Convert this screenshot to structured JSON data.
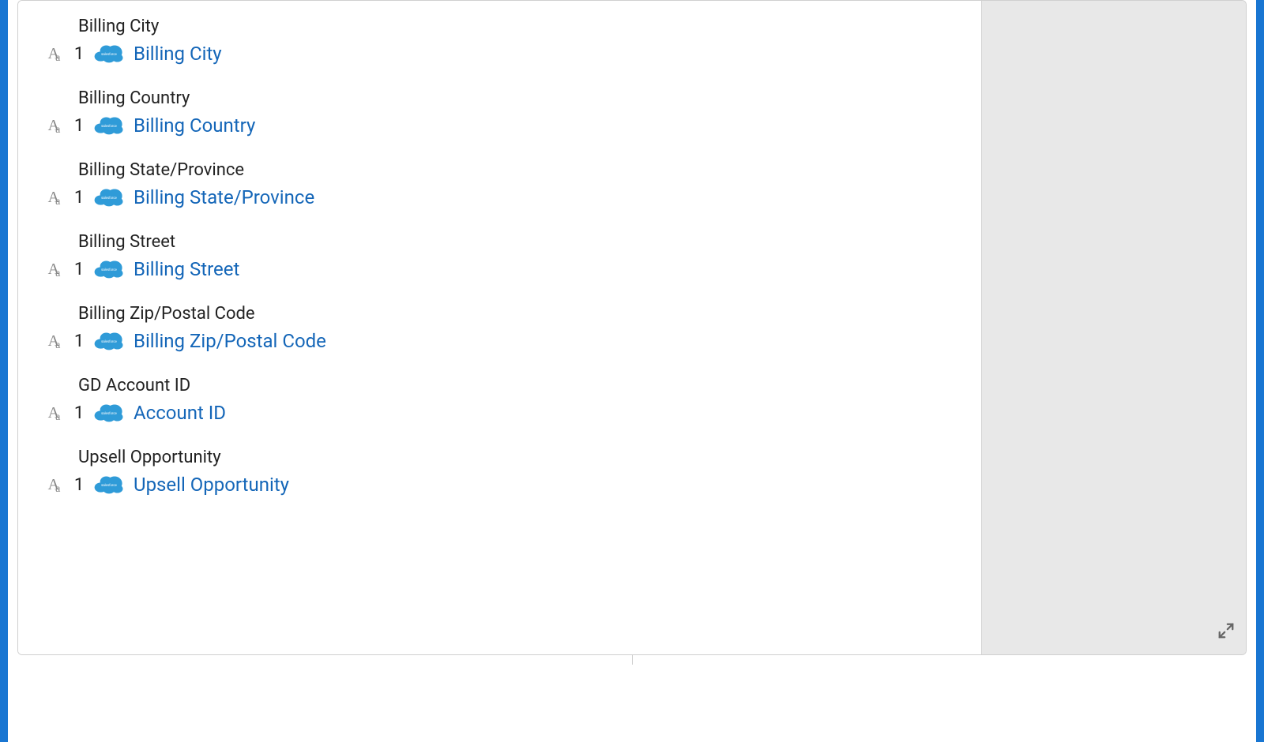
{
  "fields": [
    {
      "title": "Billing City",
      "count": "1",
      "link": "Billing City"
    },
    {
      "title": "Billing Country",
      "count": "1",
      "link": "Billing Country"
    },
    {
      "title": "Billing State/Province",
      "count": "1",
      "link": "Billing State/Province"
    },
    {
      "title": "Billing Street",
      "count": "1",
      "link": "Billing Street"
    },
    {
      "title": "Billing Zip/Postal Code",
      "count": "1",
      "link": "Billing Zip/Postal Code"
    },
    {
      "title": "GD Account ID",
      "count": "1",
      "link": "Account ID"
    },
    {
      "title": "Upsell Opportunity",
      "count": "1",
      "link": "Upsell Opportunity"
    }
  ],
  "icons": {
    "salesforce_label": "salesforce"
  }
}
